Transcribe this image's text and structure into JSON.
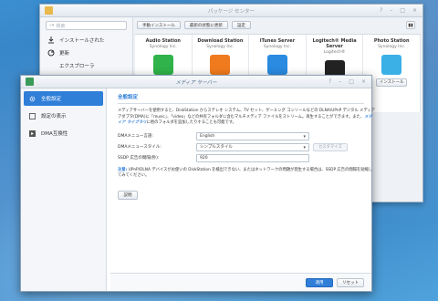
{
  "package_center": {
    "title": "パッケージ センター",
    "search_placeholder": "検索",
    "nav": [
      {
        "label": "インストールされた",
        "icon": "download-icon"
      },
      {
        "label": "更新",
        "icon": "refresh-icon"
      },
      {
        "label": "エクスプローラ",
        "icon": "explore-icon"
      }
    ],
    "toolbar": {
      "manual_install": "手動インストール",
      "manual_update": "最新の状態に更新",
      "settings": "設定"
    },
    "packages": [
      {
        "name": "Audio Station",
        "vendor": "Synology Inc.",
        "color": "#2fb34a"
      },
      {
        "name": "Download Station",
        "vendor": "Synology Inc.",
        "color": "#f07b1e"
      },
      {
        "name": "iTunes Server",
        "vendor": "Synology Inc.",
        "color": "#2a8be0"
      },
      {
        "name": "Logitech® Media Server",
        "vendor": "Logitech®",
        "color": "#222222"
      },
      {
        "name": "Photo Station",
        "vendor": "Synology Inc.",
        "color": "#3ab0e6",
        "install_label": "インストール"
      }
    ]
  },
  "media_server": {
    "title": "メディア サーバー",
    "sidebar": [
      {
        "label": "全般設定",
        "icon": "gear-icon",
        "active": true
      },
      {
        "label": "設定の表示",
        "icon": "display-icon",
        "active": false
      },
      {
        "label": "DMA互換性",
        "icon": "compat-icon",
        "active": false
      }
    ],
    "heading": "全般設定",
    "description_pre": "メディアサーバーを使用すると、DiskStation からステレオ システム、TV セット、ゲーミング コンソールなどの DLNA/UPnP デジタル メディア アダプタ(DMA)に「music」、「video」などの共有フォルダに含むマルチメディア ファイルをストリーム。再生することができます。また、",
    "description_link": "メディア ライブラリ",
    "description_post": "に他のフォルダを追加したりすることも可能です。",
    "fields": {
      "menu_language_label": "DMAメニュー言語:",
      "menu_language_value": "English",
      "menu_style_label": "DMAメニュースタイル:",
      "menu_style_value": "シンプルスタイル",
      "customize_label": "カスタマイズ",
      "ssdp_label": "SSDP 広告の間隔(秒):",
      "ssdp_value": "920"
    },
    "note_tag": "注意:",
    "note_text": " UPnP/DLNA デバイスがお使いの DiskStation を検出できない、またはネットワークの問題が発生する場合は、SSDP 広告の間隔を短縮してみてください。",
    "explain_label": "説明",
    "apply_label": "適用",
    "reset_label": "リセット"
  }
}
